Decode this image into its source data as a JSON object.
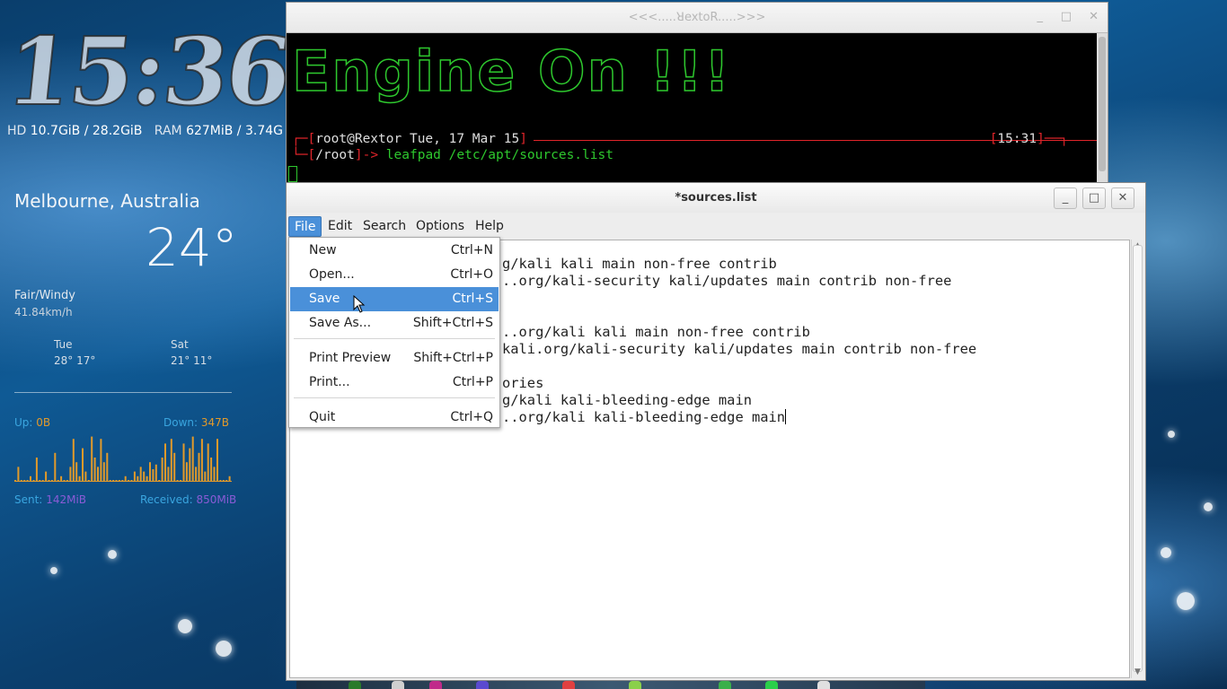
{
  "desktop": {
    "clock": "15:36",
    "sysinfo": {
      "hd_label": "HD",
      "hd_value": "10.7GiB / 28.2GiB",
      "ram_label": "RAM",
      "ram_value": "627MiB  / 3.74G"
    },
    "weather": {
      "city": "Melbourne, Australia",
      "temperature": "24°",
      "condition": "Fair/Windy",
      "wind": "41.84km/h",
      "forecast": [
        {
          "day": "Tue",
          "temps": "28° 17°"
        },
        {
          "day": "Sat",
          "temps": "21° 11°"
        }
      ]
    },
    "network": {
      "up_label": "Up:",
      "up_value": "0B",
      "down_label": "Down:",
      "down_value": "347B",
      "sent_label": "Sent:",
      "sent_value": "142MiB",
      "received_label": "Received:",
      "received_value": "850MiB",
      "graph_levels": [
        0,
        0.3,
        0,
        0,
        0,
        0.1,
        0,
        0.5,
        0,
        0,
        0.2,
        0,
        0,
        0.6,
        0,
        0.1,
        0,
        0,
        0.3,
        0.9,
        0.4,
        0.1,
        0.7,
        0.2,
        0,
        0.95,
        0.5,
        0.3,
        0.9,
        0.4,
        0.6,
        0,
        0,
        0,
        0,
        0,
        0.1,
        0,
        0,
        0.2,
        0.1,
        0.3,
        0.2,
        0.1,
        0.4,
        0.25,
        0.35,
        0,
        0.5,
        0.8,
        0.3,
        0.9,
        0.6,
        0,
        0,
        0.8,
        0.4,
        0.7,
        0.95,
        0.3,
        0.6,
        0.9,
        0.2,
        0.8,
        0.5,
        0.3,
        0.9,
        0,
        0,
        0,
        0.1
      ]
    }
  },
  "terminal": {
    "title": "<<<.....ꓤextoR.....>>>",
    "banner": "Engine On !!!",
    "prompt_user": "root@Rextor Tue, 17 Mar 15",
    "prompt_time": "15:31",
    "prompt_dir": "/root",
    "prompt_arrow": "->",
    "command": "leafpad /etc/apt/sources.list"
  },
  "leafpad": {
    "title": "*sources.list",
    "menus": [
      "File",
      "Edit",
      "Search",
      "Options",
      "Help"
    ],
    "visible_lines": [
      {
        "text": "g/kali kali main non-free contrib",
        "offset": 232
      },
      {
        "text": "..org/kali-security kali/updates main contrib non-free",
        "offset": 232
      },
      {
        "text": "",
        "offset": 232
      },
      {
        "text": "",
        "offset": 232
      },
      {
        "text": "..org/kali kali main non-free contrib",
        "offset": 232
      },
      {
        "text": "kali.org/kali-security kali/updates main contrib non-free",
        "offset": 232
      },
      {
        "text": "",
        "offset": 232
      },
      {
        "text": "ories",
        "offset": 232
      },
      {
        "text": "g/kali kali-bleeding-edge main",
        "offset": 232
      },
      {
        "text": "..org/kali kali-bleeding-edge main",
        "offset": 232
      }
    ]
  },
  "file_menu": {
    "items": [
      {
        "label": "New",
        "accel": "Ctrl+N"
      },
      {
        "label": "Open...",
        "accel": "Ctrl+O"
      },
      {
        "label": "Save",
        "accel": "Ctrl+S"
      },
      {
        "label": "Save As...",
        "accel": "Shift+Ctrl+S"
      },
      {
        "label": "Print Preview",
        "accel": "Shift+Ctrl+P"
      },
      {
        "label": "Print...",
        "accel": "Ctrl+P"
      },
      {
        "label": "Quit",
        "accel": "Ctrl+Q"
      }
    ],
    "highlighted": "Save"
  },
  "colors": {
    "accent": "#4a90d9",
    "terminal_green": "#2ec82e",
    "terminal_red": "#e0242a",
    "net_orange": "#e29a2a"
  }
}
